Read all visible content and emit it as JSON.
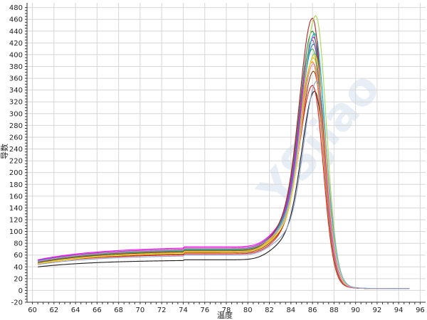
{
  "chart_data": {
    "type": "line",
    "title": "",
    "xlabel": "温度",
    "ylabel": "导数",
    "xlim": [
      59.5,
      96.5
    ],
    "ylim": [
      -20,
      488
    ],
    "x_ticks": [
      60,
      62,
      64,
      66,
      68,
      70,
      72,
      74,
      76,
      78,
      80,
      82,
      84,
      86,
      88,
      90,
      92,
      94,
      96
    ],
    "y_ticks": [
      -20,
      0,
      20,
      40,
      60,
      80,
      100,
      120,
      140,
      160,
      180,
      200,
      220,
      240,
      260,
      280,
      300,
      320,
      340,
      360,
      380,
      400,
      420,
      440,
      460,
      480
    ],
    "grid": true,
    "legend": "none",
    "watermark_text": "YSjiao",
    "x_range": [
      60.5,
      95
    ],
    "peak_x": 86,
    "series": [
      {
        "color": "#1a1a1a",
        "baseline_start": 40,
        "plateau": 52,
        "peak": 338,
        "peak_x": 86.2
      },
      {
        "color": "#e41a1c",
        "baseline_start": 46,
        "plateau": 62,
        "peak": 348,
        "peak_x": 86.0
      },
      {
        "color": "#8b4513",
        "baseline_start": 45,
        "plateau": 64,
        "peak": 372,
        "peak_x": 86.1
      },
      {
        "color": "#ff7f00",
        "baseline_start": 44,
        "plateau": 66,
        "peak": 388,
        "peak_x": 86.0
      },
      {
        "color": "#ffb000",
        "baseline_start": 47,
        "plateau": 68,
        "peak": 395,
        "peak_x": 86.1
      },
      {
        "color": "#66c2a5",
        "baseline_start": 48,
        "plateau": 69,
        "peak": 402,
        "peak_x": 86.2
      },
      {
        "color": "#4daf4a",
        "baseline_start": 49,
        "plateau": 70,
        "peak": 410,
        "peak_x": 86.0
      },
      {
        "color": "#377eb8",
        "baseline_start": 50,
        "plateau": 71,
        "peak": 418,
        "peak_x": 86.1
      },
      {
        "color": "#984ea3",
        "baseline_start": 51,
        "plateau": 72,
        "peak": 425,
        "peak_x": 86.0
      },
      {
        "color": "#ff00ff",
        "baseline_start": 52,
        "plateau": 74,
        "peak": 430,
        "peak_x": 86.1
      },
      {
        "color": "#00bcd4",
        "baseline_start": 50,
        "plateau": 70,
        "peak": 436,
        "peak_x": 86.2
      },
      {
        "color": "#2e8b57",
        "baseline_start": 48,
        "plateau": 69,
        "peak": 440,
        "peak_x": 86.0
      },
      {
        "color": "#b22222",
        "baseline_start": 47,
        "plateau": 67,
        "peak": 462,
        "peak_x": 86.0
      },
      {
        "color": "#a6d854",
        "baseline_start": 46,
        "plateau": 66,
        "peak": 466,
        "peak_x": 86.3
      },
      {
        "color": "#ffd92f",
        "baseline_start": 45,
        "plateau": 65,
        "peak": 400,
        "peak_x": 86.2
      },
      {
        "color": "#e78ac3",
        "baseline_start": 49,
        "plateau": 71,
        "peak": 385,
        "peak_x": 86.1
      },
      {
        "color": "#8da0cb",
        "baseline_start": 44,
        "plateau": 60,
        "peak": 355,
        "peak_x": 86.4
      }
    ]
  }
}
